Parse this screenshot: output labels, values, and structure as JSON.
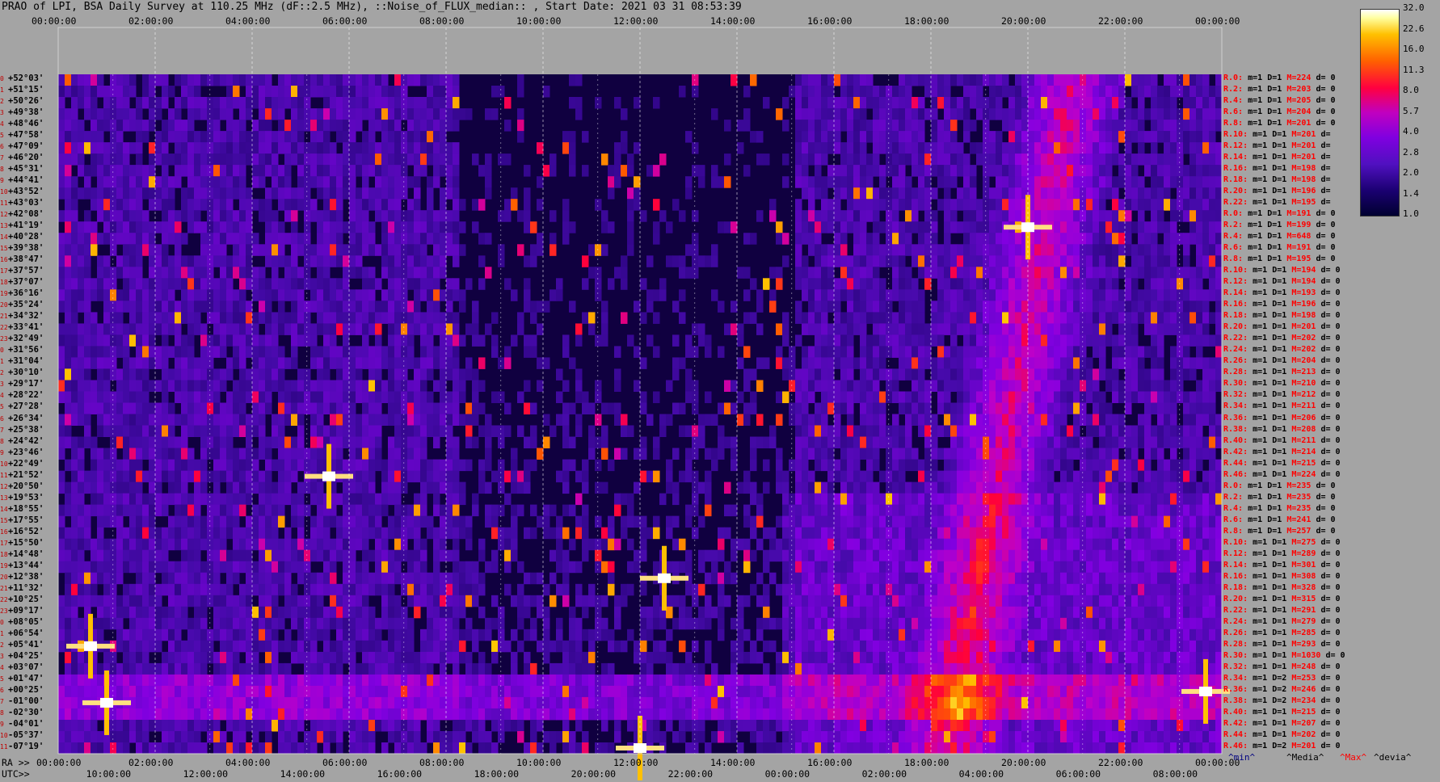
{
  "title": "PRAO of LPI, BSA Daily Survey at 110.25 MHz (dF::2.5 MHz), ::Noise_of_FLUX_median:: , Start Date: 2021 03 31 08:53:39",
  "chart_data": {
    "type": "heatmap",
    "top_ticks": [
      "00:00:00",
      "02:00:00",
      "04:00:00",
      "06:00:00",
      "08:00:00",
      "10:00:00",
      "12:00:00",
      "14:00:00",
      "16:00:00",
      "18:00:00",
      "20:00:00",
      "22:00:00",
      "00:00:00"
    ],
    "ra_prefix": "RA >>",
    "ra_ticks": [
      "00:00:00",
      "02:00:00",
      "04:00:00",
      "06:00:00",
      "08:00:00",
      "10:00:00",
      "12:00:00",
      "14:00:00",
      "16:00:00",
      "18:00:00",
      "20:00:00",
      "22:00:00",
      "00:00:00"
    ],
    "utc_prefix": "UTC>>",
    "utc_ticks": [
      "10:00:00",
      "12:00:00",
      "14:00:00",
      "16:00:00",
      "18:00:00",
      "20:00:00",
      "22:00:00",
      "00:00:00",
      "02:00:00",
      "04:00:00",
      "06:00:00",
      "08:00:00"
    ],
    "declinations": [
      "+52°03'",
      "+51°15'",
      "+50°26'",
      "+49°38'",
      "+48°46'",
      "+47°58'",
      "+47°09'",
      "+46°20'",
      "+45°31'",
      "+44°41'",
      "+43°52'",
      "+43°03'",
      "+42°08'",
      "+41°19'",
      "+40°28'",
      "+39°38'",
      "+38°47'",
      "+37°57'",
      "+37°07'",
      "+36°16'",
      "+35°24'",
      "+34°32'",
      "+33°41'",
      "+32°49'",
      "+31°56'",
      "+31°04'",
      "+30°10'",
      "+29°17'",
      "+28°22'",
      "+27°28'",
      "+26°34'",
      "+25°38'",
      "+24°42'",
      "+23°46'",
      "+22°49'",
      "+21°52'",
      "+20°50'",
      "+19°53'",
      "+18°55'",
      "+17°55'",
      "+16°52'",
      "+15°50'",
      "+14°48'",
      "+13°44'",
      "+12°38'",
      "+11°32'",
      "+10°25'",
      "+09°17'",
      "+08°05'",
      "+06°54'",
      "+05°41'",
      "+04°25'",
      "+03°07'",
      "+01°47'",
      "+00°25'",
      "-01°00'",
      "-02°30'",
      "-04°01'",
      "-05°37'",
      "-07°19'"
    ],
    "row_index": [
      "0",
      "1",
      "2",
      "3",
      "4",
      "5",
      "6",
      "7",
      "8",
      "9",
      "10",
      "11",
      "12",
      "13",
      "14",
      "15",
      "16",
      "17",
      "18",
      "19",
      "20",
      "21",
      "22",
      "23",
      "0",
      "1",
      "2",
      "3",
      "4",
      "5",
      "6",
      "7",
      "8",
      "9",
      "10",
      "11",
      "12",
      "13",
      "14",
      "15",
      "16",
      "17",
      "18",
      "19",
      "20",
      "21",
      "22",
      "23",
      "0",
      "1",
      "2",
      "3",
      "4",
      "5",
      "6",
      "7",
      "8",
      "9",
      "10",
      "11"
    ],
    "beam_stats": [
      {
        "r": "R.0:",
        "m": "m=1",
        "d": "D=1",
        "max": "M=224",
        "dev": "d= 0"
      },
      {
        "r": "R.2:",
        "m": "m=1",
        "d": "D=1",
        "max": "M=203",
        "dev": "d= 0"
      },
      {
        "r": "R.4:",
        "m": "m=1",
        "d": "D=1",
        "max": "M=205",
        "dev": "d= 0"
      },
      {
        "r": "R.6:",
        "m": "m=1",
        "d": "D=1",
        "max": "M=204",
        "dev": "d= 0"
      },
      {
        "r": "R.8:",
        "m": "m=1",
        "d": "D=1",
        "max": "M=201",
        "dev": "d= 0"
      },
      {
        "r": "R.10:",
        "m": "m=1",
        "d": "D=1",
        "max": "M=201",
        "dev": "d="
      },
      {
        "r": "R.12:",
        "m": "m=1",
        "d": "D=1",
        "max": "M=201",
        "dev": "d="
      },
      {
        "r": "R.14:",
        "m": "m=1",
        "d": "D=1",
        "max": "M=201",
        "dev": "d="
      },
      {
        "r": "R.16:",
        "m": "m=1",
        "d": "D=1",
        "max": "M=198",
        "dev": "d="
      },
      {
        "r": "R.18:",
        "m": "m=1",
        "d": "D=1",
        "max": "M=198",
        "dev": "d="
      },
      {
        "r": "R.20:",
        "m": "m=1",
        "d": "D=1",
        "max": "M=196",
        "dev": "d="
      },
      {
        "r": "R.22:",
        "m": "m=1",
        "d": "D=1",
        "max": "M=195",
        "dev": "d="
      },
      {
        "r": "R.0:",
        "m": "m=1",
        "d": "D=1",
        "max": "M=191",
        "dev": "d= 0"
      },
      {
        "r": "R.2:",
        "m": "m=1",
        "d": "D=1",
        "max": "M=199",
        "dev": "d= 0"
      },
      {
        "r": "R.4:",
        "m": "m=1",
        "d": "D=1",
        "max": "M=648",
        "dev": "d= 0"
      },
      {
        "r": "R.6:",
        "m": "m=1",
        "d": "D=1",
        "max": "M=191",
        "dev": "d= 0"
      },
      {
        "r": "R.8:",
        "m": "m=1",
        "d": "D=1",
        "max": "M=195",
        "dev": "d= 0"
      },
      {
        "r": "R.10:",
        "m": "m=1",
        "d": "D=1",
        "max": "M=194",
        "dev": "d= 0"
      },
      {
        "r": "R.12:",
        "m": "m=1",
        "d": "D=1",
        "max": "M=194",
        "dev": "d= 0"
      },
      {
        "r": "R.14:",
        "m": "m=1",
        "d": "D=1",
        "max": "M=193",
        "dev": "d= 0"
      },
      {
        "r": "R.16:",
        "m": "m=1",
        "d": "D=1",
        "max": "M=196",
        "dev": "d= 0"
      },
      {
        "r": "R.18:",
        "m": "m=1",
        "d": "D=1",
        "max": "M=198",
        "dev": "d= 0"
      },
      {
        "r": "R.20:",
        "m": "m=1",
        "d": "D=1",
        "max": "M=201",
        "dev": "d= 0"
      },
      {
        "r": "R.22:",
        "m": "m=1",
        "d": "D=1",
        "max": "M=202",
        "dev": "d= 0"
      },
      {
        "r": "R.24:",
        "m": "m=1",
        "d": "D=1",
        "max": "M=202",
        "dev": "d= 0"
      },
      {
        "r": "R.26:",
        "m": "m=1",
        "d": "D=1",
        "max": "M=204",
        "dev": "d= 0"
      },
      {
        "r": "R.28:",
        "m": "m=1",
        "d": "D=1",
        "max": "M=213",
        "dev": "d= 0"
      },
      {
        "r": "R.30:",
        "m": "m=1",
        "d": "D=1",
        "max": "M=210",
        "dev": "d= 0"
      },
      {
        "r": "R.32:",
        "m": "m=1",
        "d": "D=1",
        "max": "M=212",
        "dev": "d= 0"
      },
      {
        "r": "R.34:",
        "m": "m=1",
        "d": "D=1",
        "max": "M=211",
        "dev": "d= 0"
      },
      {
        "r": "R.36:",
        "m": "m=1",
        "d": "D=1",
        "max": "M=206",
        "dev": "d= 0"
      },
      {
        "r": "R.38:",
        "m": "m=1",
        "d": "D=1",
        "max": "M=208",
        "dev": "d= 0"
      },
      {
        "r": "R.40:",
        "m": "m=1",
        "d": "D=1",
        "max": "M=211",
        "dev": "d= 0"
      },
      {
        "r": "R.42:",
        "m": "m=1",
        "d": "D=1",
        "max": "M=214",
        "dev": "d= 0"
      },
      {
        "r": "R.44:",
        "m": "m=1",
        "d": "D=1",
        "max": "M=215",
        "dev": "d= 0"
      },
      {
        "r": "R.46:",
        "m": "m=1",
        "d": "D=1",
        "max": "M=224",
        "dev": "d= 0"
      },
      {
        "r": "R.0:",
        "m": "m=1",
        "d": "D=1",
        "max": "M=235",
        "dev": "d= 0"
      },
      {
        "r": "R.2:",
        "m": "m=1",
        "d": "D=1",
        "max": "M=235",
        "dev": "d= 0"
      },
      {
        "r": "R.4:",
        "m": "m=1",
        "d": "D=1",
        "max": "M=235",
        "dev": "d= 0"
      },
      {
        "r": "R.6:",
        "m": "m=1",
        "d": "D=1",
        "max": "M=241",
        "dev": "d= 0"
      },
      {
        "r": "R.8:",
        "m": "m=1",
        "d": "D=1",
        "max": "M=257",
        "dev": "d= 0"
      },
      {
        "r": "R.10:",
        "m": "m=1",
        "d": "D=1",
        "max": "M=275",
        "dev": "d= 0"
      },
      {
        "r": "R.12:",
        "m": "m=1",
        "d": "D=1",
        "max": "M=289",
        "dev": "d= 0"
      },
      {
        "r": "R.14:",
        "m": "m=1",
        "d": "D=1",
        "max": "M=301",
        "dev": "d= 0"
      },
      {
        "r": "R.16:",
        "m": "m=1",
        "d": "D=1",
        "max": "M=308",
        "dev": "d= 0"
      },
      {
        "r": "R.18:",
        "m": "m=1",
        "d": "D=1",
        "max": "M=328",
        "dev": "d= 0"
      },
      {
        "r": "R.20:",
        "m": "m=1",
        "d": "D=1",
        "max": "M=315",
        "dev": "d= 0"
      },
      {
        "r": "R.22:",
        "m": "m=1",
        "d": "D=1",
        "max": "M=291",
        "dev": "d= 0"
      },
      {
        "r": "R.24:",
        "m": "m=1",
        "d": "D=1",
        "max": "M=279",
        "dev": "d= 0"
      },
      {
        "r": "R.26:",
        "m": "m=1",
        "d": "D=1",
        "max": "M=285",
        "dev": "d= 0"
      },
      {
        "r": "R.28:",
        "m": "m=1",
        "d": "D=1",
        "max": "M=293",
        "dev": "d= 0"
      },
      {
        "r": "R.30:",
        "m": "m=1",
        "d": "D=1",
        "max": "M=1030",
        "dev": "d= 0"
      },
      {
        "r": "R.32:",
        "m": "m=1",
        "d": "D=1",
        "max": "M=248",
        "dev": "d= 0"
      },
      {
        "r": "R.34:",
        "m": "m=1",
        "d": "D=2",
        "max": "M=253",
        "dev": "d= 0"
      },
      {
        "r": "R.36:",
        "m": "m=1",
        "d": "D=2",
        "max": "M=246",
        "dev": "d= 0"
      },
      {
        "r": "R.38:",
        "m": "m=1",
        "d": "D=2",
        "max": "M=234",
        "dev": "d= 0"
      },
      {
        "r": "R.40:",
        "m": "m=1",
        "d": "D=1",
        "max": "M=215",
        "dev": "d= 0"
      },
      {
        "r": "R.42:",
        "m": "m=1",
        "d": "D=1",
        "max": "M=207",
        "dev": "d= 0"
      },
      {
        "r": "R.44:",
        "m": "m=1",
        "d": "D=1",
        "max": "M=202",
        "dev": "d= 0"
      },
      {
        "r": "R.46:",
        "m": "m=1",
        "d": "D=2",
        "max": "M=201",
        "dev": "d= 0"
      }
    ],
    "colorbar_ticks": [
      "32.0",
      "22.6",
      "16.0",
      "11.3",
      "8.0",
      "5.7",
      "4.0",
      "2.8",
      "2.0",
      "1.4",
      "1.0"
    ],
    "legend": [
      "^min^",
      "^Media^",
      "^Max^",
      "^devia^"
    ],
    "colors": {
      "background": "#a4a4a4",
      "min": "#000080",
      "media": "#000000",
      "max": "#ff0000",
      "devia": "#000000"
    },
    "sources": [
      {
        "ra": "00:40",
        "dec": "+05°41'",
        "peak": 32
      },
      {
        "ra": "01:00",
        "dec": "-01°00'",
        "peak": 20
      },
      {
        "ra": "20:00",
        "dec": "+41°19'",
        "peak": 32
      },
      {
        "ra": "05:35",
        "dec": "+21°52'",
        "peak": 25
      },
      {
        "ra": "12:30",
        "dec": "+12°38'",
        "peak": 25
      },
      {
        "ra": "12:00",
        "dec": "-07°19'",
        "peak": 25
      },
      {
        "ra": "23:40",
        "dec": "+00°25'",
        "peak": 20
      }
    ]
  }
}
